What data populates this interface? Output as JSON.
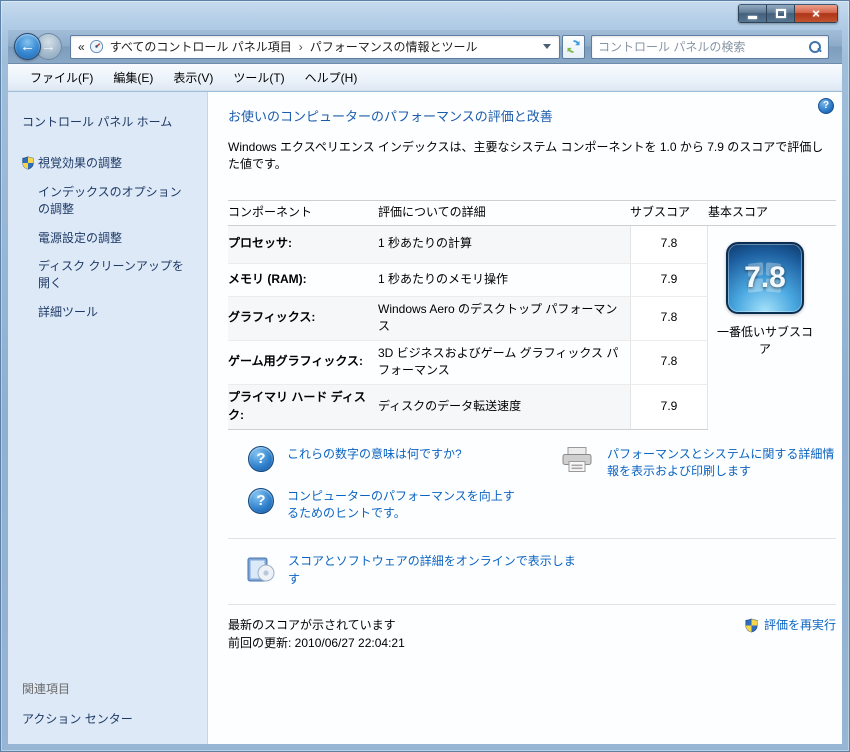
{
  "glyphs": {
    "overflow": "«",
    "separator": "›",
    "back": "←",
    "forward": "→",
    "question": "?",
    "close": "×"
  },
  "navbar": {
    "breadcrumb": {
      "items": [
        "すべてのコントロール パネル項目",
        "パフォーマンスの情報とツール"
      ]
    },
    "search": {
      "placeholder": "コントロール パネルの検索"
    }
  },
  "menubar": {
    "items": [
      "ファイル(F)",
      "編集(E)",
      "表示(V)",
      "ツール(T)",
      "ヘルプ(H)"
    ]
  },
  "sidebar": {
    "home": "コントロール パネル ホーム",
    "tasks": [
      {
        "label": "視覚効果の調整"
      },
      {
        "label": "インデックスのオプションの調整"
      },
      {
        "label": "電源設定の調整"
      },
      {
        "label": "ディスク クリーンアップを開く"
      },
      {
        "label": "詳細ツール"
      }
    ],
    "related_header": "関連項目",
    "related_items": [
      "アクション センター"
    ]
  },
  "main": {
    "title": "お使いのコンピューターのパフォーマンスの評価と改善",
    "intro": "Windows エクスペリエンス インデックスは、主要なシステム コンポーネントを 1.0 から 7.9 のスコアで評価した値です。",
    "table": {
      "headers": [
        "コンポーネント",
        "評価についての詳細",
        "サブスコア",
        "基本スコア"
      ],
      "rows": [
        {
          "component": "プロセッサ:",
          "detail": "1 秒あたりの計算",
          "subscore": "7.8"
        },
        {
          "component": "メモリ (RAM):",
          "detail": "1 秒あたりのメモリ操作",
          "subscore": "7.9"
        },
        {
          "component": "グラフィックス:",
          "detail": "Windows Aero のデスクトップ パフォーマンス",
          "subscore": "7.8"
        },
        {
          "component": "ゲーム用グラフィックス:",
          "detail": "3D ビジネスおよびゲーム グラフィックス パフォーマンス",
          "subscore": "7.8"
        },
        {
          "component": "プライマリ ハード ディスク:",
          "detail": "ディスクのデータ転送速度",
          "subscore": "7.9"
        }
      ]
    },
    "base_score": {
      "value": "7.8",
      "caption": "一番低いサブスコア"
    },
    "links": {
      "meaning": "これらの数字の意味は何ですか?",
      "tips": "コンピューターのパフォーマンスを向上するためのヒントです。",
      "print": "パフォーマンスとシステムに関する詳細情報を表示および印刷します",
      "online": "スコアとソフトウェアの詳細をオンラインで表示します",
      "rerun": "評価を再実行"
    },
    "status": {
      "line1": "最新のスコアが示されています",
      "line2": "前回の更新: 2010/06/27 22:04:21"
    }
  }
}
